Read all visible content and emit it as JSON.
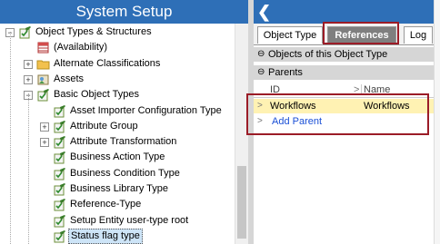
{
  "left_panel": {
    "title": "System Setup",
    "tree": [
      {
        "label": "Object Types & Structures",
        "icon": "pencil-check-icon",
        "level": 1,
        "toggle": "-"
      },
      {
        "label": "(Availability)",
        "icon": "table-icon",
        "level": 2,
        "toggle": ""
      },
      {
        "label": "Alternate Classifications",
        "icon": "folder-icon",
        "level": 2,
        "toggle": "+"
      },
      {
        "label": "Assets",
        "icon": "asset-icon",
        "level": 2,
        "toggle": "+"
      },
      {
        "label": "Basic Object Types",
        "icon": "pencil-check-icon",
        "level": 2,
        "toggle": "-"
      },
      {
        "label": "Asset Importer Configuration Type",
        "icon": "pencil-check-icon",
        "level": 3,
        "toggle": ""
      },
      {
        "label": "Attribute Group",
        "icon": "pencil-check-icon",
        "level": 3,
        "toggle": "+"
      },
      {
        "label": "Attribute Transformation",
        "icon": "pencil-check-icon",
        "level": 3,
        "toggle": "+"
      },
      {
        "label": "Business Action Type",
        "icon": "pencil-check-icon",
        "level": 3,
        "toggle": ""
      },
      {
        "label": "Business Condition Type",
        "icon": "pencil-check-icon",
        "level": 3,
        "toggle": ""
      },
      {
        "label": "Business Library Type",
        "icon": "pencil-check-icon",
        "level": 3,
        "toggle": ""
      },
      {
        "label": "Reference-Type",
        "icon": "pencil-check-icon",
        "level": 3,
        "toggle": ""
      },
      {
        "label": "Setup Entity user-type root",
        "icon": "pencil-check-icon",
        "level": 3,
        "toggle": ""
      },
      {
        "label": "Status flag type",
        "icon": "pencil-check-icon",
        "level": 3,
        "toggle": "",
        "selected": true
      }
    ]
  },
  "right_panel": {
    "back_glyph": "❮",
    "tabs": [
      {
        "label": "Object Type"
      },
      {
        "label": "References",
        "active": true
      },
      {
        "label": "Log"
      }
    ],
    "section_objects": "Objects of this  Object Type",
    "section_parents": "Parents",
    "columns": {
      "id": "ID",
      "name": "Name",
      "sort_glyph": ">"
    },
    "rows": [
      {
        "id": "Workflows",
        "name": "Workflows"
      }
    ],
    "add_parent": "Add Parent"
  },
  "colors": {
    "header_blue": "#2e6fb7",
    "highlight_red": "#9b1c27",
    "row_yellow": "#fff2b3",
    "link_blue": "#1a4fd6"
  }
}
